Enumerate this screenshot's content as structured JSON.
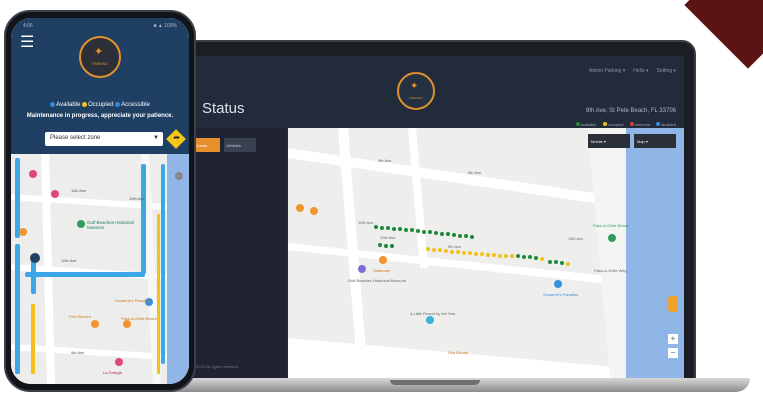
{
  "phone": {
    "status_left": "4:06",
    "status_right": "■ ▲ 100%",
    "logo_text": "PARKING",
    "legend": {
      "available": "Available",
      "occupied": "Occupied",
      "accessible": "Accessible"
    },
    "notice": "Maintenance in progress, appreciate your patience.",
    "zone_select": {
      "placeholder": "Please select zone"
    },
    "map_labels": {
      "street1": "11th Ave",
      "street2": "10th Ave",
      "street3": "10th Ave",
      "museum": "Gulf Beaches Historical Museum",
      "cafe1": "Suzanne's Paradise",
      "cafe2": "Fish Kitchen",
      "cafe3": "Pass-A-Grille Beach",
      "shop": "La Tortuga",
      "road": "9th Ave"
    }
  },
  "laptop": {
    "title": "Status",
    "logo_text": "PARKING",
    "nav": [
      "Admin Parking ▾",
      "Hello ▾",
      "Setting ▾"
    ],
    "date": "9th Ave, St Pete Beach, FL 33706",
    "legend": [
      "available",
      "occupied",
      "reserved",
      "disabled"
    ],
    "sidebar_buttons": [
      "Zones",
      "Vehicles"
    ],
    "footer": "© 2023 All rights reserved.",
    "map_controls": [
      "Mobile ▾",
      "Map ▾"
    ],
    "map_labels": {
      "street1": "10th Ave",
      "street2": "10th Ave",
      "street3": "11th Ave",
      "street4": "9th Ave",
      "street5": "9th Ave",
      "street6": "8th Ave",
      "museum": "Gulf Beaches Historical Museum",
      "place1": "Suzanne's Paradise",
      "place2": "Pass-A-Grille Beach",
      "place3": "A Little Resort by the Sea",
      "place4": "Sea Dunes",
      "place5": "Seahorse",
      "road": "Pass-A-Grille Way"
    }
  },
  "colors": {
    "accent": "#e5902c",
    "header_blue": "#1f3f63",
    "available": "#1f8a3a",
    "occupied": "#f2c21b",
    "accessible": "#2f8be0",
    "water": "#8fb6e6"
  }
}
